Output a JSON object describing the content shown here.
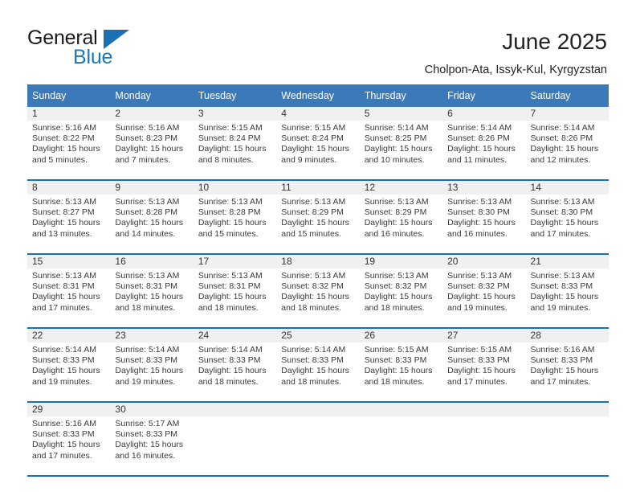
{
  "brand": {
    "line1": "General",
    "line2": "Blue",
    "mark": "triangle-logo"
  },
  "header": {
    "title": "June 2025",
    "location": "Cholpon-Ata, Issyk-Kul, Kyrgyzstan"
  },
  "theme": {
    "header_blue": "#3b79b8",
    "rule_blue": "#1b6fb5",
    "daynum_bg": "#f0f0f0",
    "brand_blue": "#1878be"
  },
  "calendar": {
    "weekday_headers": [
      "Sunday",
      "Monday",
      "Tuesday",
      "Wednesday",
      "Thursday",
      "Friday",
      "Saturday"
    ],
    "weeks": [
      [
        {
          "day": "1",
          "sunrise": "Sunrise: 5:16 AM",
          "sunset": "Sunset: 8:22 PM",
          "daylight1": "Daylight: 15 hours",
          "daylight2": "and 5 minutes."
        },
        {
          "day": "2",
          "sunrise": "Sunrise: 5:16 AM",
          "sunset": "Sunset: 8:23 PM",
          "daylight1": "Daylight: 15 hours",
          "daylight2": "and 7 minutes."
        },
        {
          "day": "3",
          "sunrise": "Sunrise: 5:15 AM",
          "sunset": "Sunset: 8:24 PM",
          "daylight1": "Daylight: 15 hours",
          "daylight2": "and 8 minutes."
        },
        {
          "day": "4",
          "sunrise": "Sunrise: 5:15 AM",
          "sunset": "Sunset: 8:24 PM",
          "daylight1": "Daylight: 15 hours",
          "daylight2": "and 9 minutes."
        },
        {
          "day": "5",
          "sunrise": "Sunrise: 5:14 AM",
          "sunset": "Sunset: 8:25 PM",
          "daylight1": "Daylight: 15 hours",
          "daylight2": "and 10 minutes."
        },
        {
          "day": "6",
          "sunrise": "Sunrise: 5:14 AM",
          "sunset": "Sunset: 8:26 PM",
          "daylight1": "Daylight: 15 hours",
          "daylight2": "and 11 minutes."
        },
        {
          "day": "7",
          "sunrise": "Sunrise: 5:14 AM",
          "sunset": "Sunset: 8:26 PM",
          "daylight1": "Daylight: 15 hours",
          "daylight2": "and 12 minutes."
        }
      ],
      [
        {
          "day": "8",
          "sunrise": "Sunrise: 5:13 AM",
          "sunset": "Sunset: 8:27 PM",
          "daylight1": "Daylight: 15 hours",
          "daylight2": "and 13 minutes."
        },
        {
          "day": "9",
          "sunrise": "Sunrise: 5:13 AM",
          "sunset": "Sunset: 8:28 PM",
          "daylight1": "Daylight: 15 hours",
          "daylight2": "and 14 minutes."
        },
        {
          "day": "10",
          "sunrise": "Sunrise: 5:13 AM",
          "sunset": "Sunset: 8:28 PM",
          "daylight1": "Daylight: 15 hours",
          "daylight2": "and 15 minutes."
        },
        {
          "day": "11",
          "sunrise": "Sunrise: 5:13 AM",
          "sunset": "Sunset: 8:29 PM",
          "daylight1": "Daylight: 15 hours",
          "daylight2": "and 15 minutes."
        },
        {
          "day": "12",
          "sunrise": "Sunrise: 5:13 AM",
          "sunset": "Sunset: 8:29 PM",
          "daylight1": "Daylight: 15 hours",
          "daylight2": "and 16 minutes."
        },
        {
          "day": "13",
          "sunrise": "Sunrise: 5:13 AM",
          "sunset": "Sunset: 8:30 PM",
          "daylight1": "Daylight: 15 hours",
          "daylight2": "and 16 minutes."
        },
        {
          "day": "14",
          "sunrise": "Sunrise: 5:13 AM",
          "sunset": "Sunset: 8:30 PM",
          "daylight1": "Daylight: 15 hours",
          "daylight2": "and 17 minutes."
        }
      ],
      [
        {
          "day": "15",
          "sunrise": "Sunrise: 5:13 AM",
          "sunset": "Sunset: 8:31 PM",
          "daylight1": "Daylight: 15 hours",
          "daylight2": "and 17 minutes."
        },
        {
          "day": "16",
          "sunrise": "Sunrise: 5:13 AM",
          "sunset": "Sunset: 8:31 PM",
          "daylight1": "Daylight: 15 hours",
          "daylight2": "and 18 minutes."
        },
        {
          "day": "17",
          "sunrise": "Sunrise: 5:13 AM",
          "sunset": "Sunset: 8:31 PM",
          "daylight1": "Daylight: 15 hours",
          "daylight2": "and 18 minutes."
        },
        {
          "day": "18",
          "sunrise": "Sunrise: 5:13 AM",
          "sunset": "Sunset: 8:32 PM",
          "daylight1": "Daylight: 15 hours",
          "daylight2": "and 18 minutes."
        },
        {
          "day": "19",
          "sunrise": "Sunrise: 5:13 AM",
          "sunset": "Sunset: 8:32 PM",
          "daylight1": "Daylight: 15 hours",
          "daylight2": "and 18 minutes."
        },
        {
          "day": "20",
          "sunrise": "Sunrise: 5:13 AM",
          "sunset": "Sunset: 8:32 PM",
          "daylight1": "Daylight: 15 hours",
          "daylight2": "and 19 minutes."
        },
        {
          "day": "21",
          "sunrise": "Sunrise: 5:13 AM",
          "sunset": "Sunset: 8:33 PM",
          "daylight1": "Daylight: 15 hours",
          "daylight2": "and 19 minutes."
        }
      ],
      [
        {
          "day": "22",
          "sunrise": "Sunrise: 5:14 AM",
          "sunset": "Sunset: 8:33 PM",
          "daylight1": "Daylight: 15 hours",
          "daylight2": "and 19 minutes."
        },
        {
          "day": "23",
          "sunrise": "Sunrise: 5:14 AM",
          "sunset": "Sunset: 8:33 PM",
          "daylight1": "Daylight: 15 hours",
          "daylight2": "and 19 minutes."
        },
        {
          "day": "24",
          "sunrise": "Sunrise: 5:14 AM",
          "sunset": "Sunset: 8:33 PM",
          "daylight1": "Daylight: 15 hours",
          "daylight2": "and 18 minutes."
        },
        {
          "day": "25",
          "sunrise": "Sunrise: 5:14 AM",
          "sunset": "Sunset: 8:33 PM",
          "daylight1": "Daylight: 15 hours",
          "daylight2": "and 18 minutes."
        },
        {
          "day": "26",
          "sunrise": "Sunrise: 5:15 AM",
          "sunset": "Sunset: 8:33 PM",
          "daylight1": "Daylight: 15 hours",
          "daylight2": "and 18 minutes."
        },
        {
          "day": "27",
          "sunrise": "Sunrise: 5:15 AM",
          "sunset": "Sunset: 8:33 PM",
          "daylight1": "Daylight: 15 hours",
          "daylight2": "and 17 minutes."
        },
        {
          "day": "28",
          "sunrise": "Sunrise: 5:16 AM",
          "sunset": "Sunset: 8:33 PM",
          "daylight1": "Daylight: 15 hours",
          "daylight2": "and 17 minutes."
        }
      ],
      [
        {
          "day": "29",
          "sunrise": "Sunrise: 5:16 AM",
          "sunset": "Sunset: 8:33 PM",
          "daylight1": "Daylight: 15 hours",
          "daylight2": "and 17 minutes."
        },
        {
          "day": "30",
          "sunrise": "Sunrise: 5:17 AM",
          "sunset": "Sunset: 8:33 PM",
          "daylight1": "Daylight: 15 hours",
          "daylight2": "and 16 minutes."
        },
        {
          "day": "",
          "sunrise": "",
          "sunset": "",
          "daylight1": "",
          "daylight2": ""
        },
        {
          "day": "",
          "sunrise": "",
          "sunset": "",
          "daylight1": "",
          "daylight2": ""
        },
        {
          "day": "",
          "sunrise": "",
          "sunset": "",
          "daylight1": "",
          "daylight2": ""
        },
        {
          "day": "",
          "sunrise": "",
          "sunset": "",
          "daylight1": "",
          "daylight2": ""
        },
        {
          "day": "",
          "sunrise": "",
          "sunset": "",
          "daylight1": "",
          "daylight2": ""
        }
      ]
    ]
  }
}
